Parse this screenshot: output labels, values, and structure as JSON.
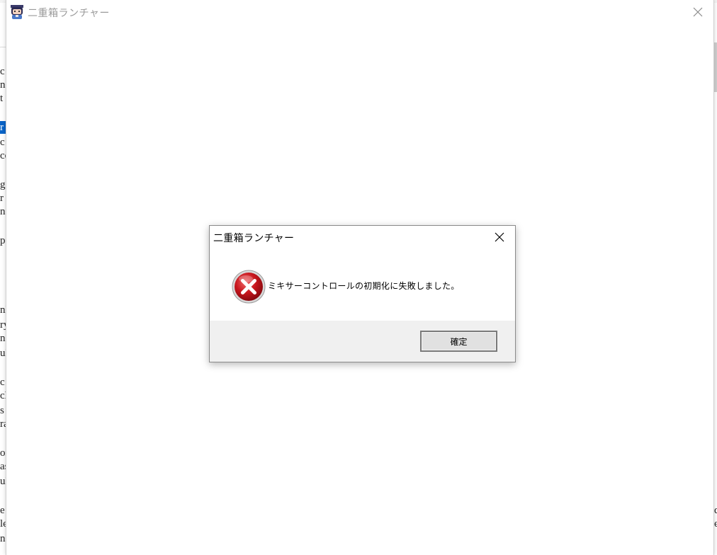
{
  "background_document": {
    "left_fragments": [
      "c",
      "n",
      "t",
      "r",
      "c",
      "co",
      "ga",
      "r",
      "ne",
      "p",
      "nl",
      "ry",
      "n",
      "ul",
      "c",
      "cl",
      "s",
      "ra",
      "or",
      "as",
      "ul",
      "e",
      "le",
      "n"
    ],
    "right_fragments": [
      "d",
      "e"
    ]
  },
  "app_window": {
    "title": "二重箱ランチャー",
    "icon": "app-character-icon"
  },
  "dialog": {
    "title": "二重箱ランチャー",
    "message": "ミキサーコントロールの初期化に失敗しました。",
    "icon": "error-icon",
    "ok_label": "確定"
  },
  "colors": {
    "error_red": "#c8161d",
    "dialog_footer": "#f0f0f0",
    "button_face": "#e1e1e1",
    "inactive_title": "#9a9a9a"
  }
}
